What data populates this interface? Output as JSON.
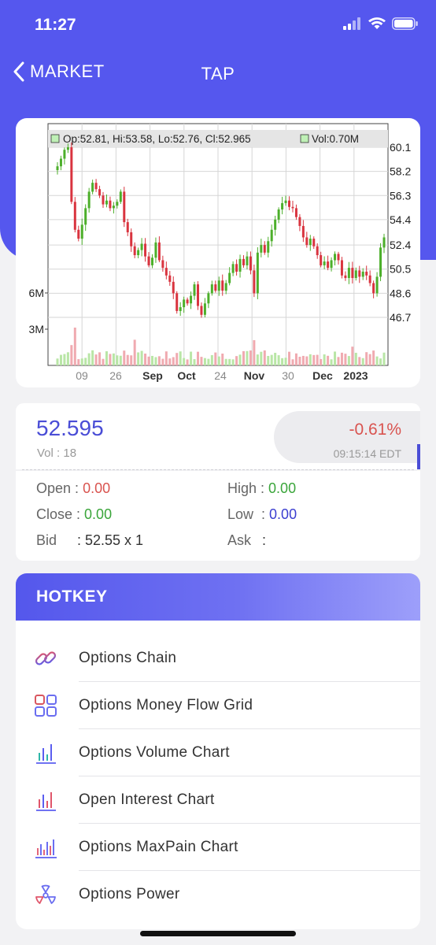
{
  "status": {
    "time": "11:27"
  },
  "nav": {
    "back_label": "MARKET",
    "title": "TAP"
  },
  "chart_info": {
    "ohlc": "Op:52.81, Hi:53.58, Lo:52.76, Cl:52.965",
    "vol": "Vol:0.70M"
  },
  "chart_data": {
    "type": "candlestick",
    "price_ticks": [
      "60.1",
      "58.2",
      "56.3",
      "54.4",
      "52.4",
      "50.5",
      "48.6",
      "46.7"
    ],
    "volume_ticks": [
      "6M",
      "3M"
    ],
    "x_labels": [
      "09",
      "26",
      "Sep",
      "Oct",
      "24",
      "Nov",
      "30",
      "Dec",
      "2023"
    ],
    "ohlc_readout": {
      "open": 52.81,
      "high": 53.58,
      "low": 52.76,
      "close": 52.965,
      "volume": "0.70M"
    },
    "closes": [
      58.6,
      59.2,
      59.9,
      60.1,
      55.8,
      53.6,
      52.9,
      54.0,
      55.3,
      56.6,
      57.3,
      56.8,
      56.3,
      55.6,
      55.9,
      55.3,
      55.5,
      55.8,
      56.6,
      54.2,
      53.4,
      52.3,
      51.6,
      52.0,
      52.5,
      51.5,
      50.8,
      51.4,
      52.6,
      51.2,
      50.6,
      50.0,
      49.5,
      48.6,
      47.2,
      47.5,
      48.1,
      47.8,
      48.4,
      49.3,
      47.6,
      46.9,
      47.8,
      48.6,
      49.3,
      48.8,
      49.6,
      48.8,
      49.4,
      50.2,
      50.9,
      50.3,
      51.3,
      50.8,
      51.5,
      50.4,
      48.6,
      51.8,
      52.4,
      51.8,
      52.7,
      53.6,
      54.4,
      55.2,
      55.7,
      55.9,
      55.4,
      55.3,
      54.6,
      53.9,
      53.0,
      52.4,
      52.9,
      52.3,
      51.6,
      50.8,
      51.1,
      50.6,
      51.2,
      51.7,
      51.2,
      50.0,
      49.8,
      50.6,
      49.8,
      50.4,
      49.9,
      50.3,
      50.0,
      49.4,
      48.6,
      49.9,
      52.2,
      53.0
    ]
  },
  "quote": {
    "price": "52.595",
    "vol_label": "Vol : 18",
    "change": "-0.61%",
    "time": "09:15:14 EDT"
  },
  "details": {
    "open_label": "Open :",
    "open_value": "0.00",
    "high_label": "High :",
    "high_value": "0.00",
    "close_label": "Close :",
    "close_value": "0.00",
    "low_label": "Low  :",
    "low_value": "0.00",
    "bid_label": "Bid",
    "bid_value": ": 52.55 x 1",
    "ask_label": "Ask",
    "ask_value": ":"
  },
  "hotkey": {
    "title": "HOTKEY",
    "items": [
      {
        "label": "Options Chain",
        "icon": "link-icon"
      },
      {
        "label": "Options Money Flow Grid",
        "icon": "grid-icon"
      },
      {
        "label": "Options Volume Chart",
        "icon": "bar-chart-icon"
      },
      {
        "label": "Open Interest Chart",
        "icon": "bar-chart-icon"
      },
      {
        "label": "Options MaxPain Chart",
        "icon": "bar-chart-icon"
      },
      {
        "label": "Options Power",
        "icon": "radiation-icon"
      }
    ]
  },
  "colors": {
    "brand": "#5557ee",
    "up": "#4caf2a",
    "down": "#d9343f",
    "negative": "#d9534f",
    "positive": "#3aa53a"
  }
}
